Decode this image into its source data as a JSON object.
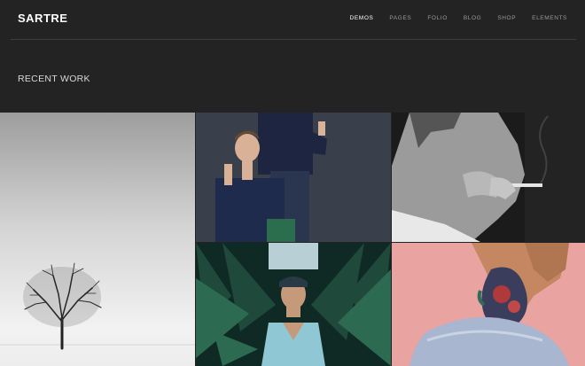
{
  "header": {
    "logo": "SARTRE",
    "nav": [
      {
        "label": "DEMOS",
        "active": true
      },
      {
        "label": "PAGES",
        "active": false
      },
      {
        "label": "FOLIO",
        "active": false
      },
      {
        "label": "BLOG",
        "active": false
      },
      {
        "label": "SHOP",
        "active": false
      },
      {
        "label": "ELEMENTS",
        "active": false
      }
    ]
  },
  "main": {
    "section_title": "RECENT WORK"
  },
  "colors": {
    "background": "#232323",
    "nav_active": "#ffffff",
    "nav_inactive": "#9a9a9a"
  }
}
